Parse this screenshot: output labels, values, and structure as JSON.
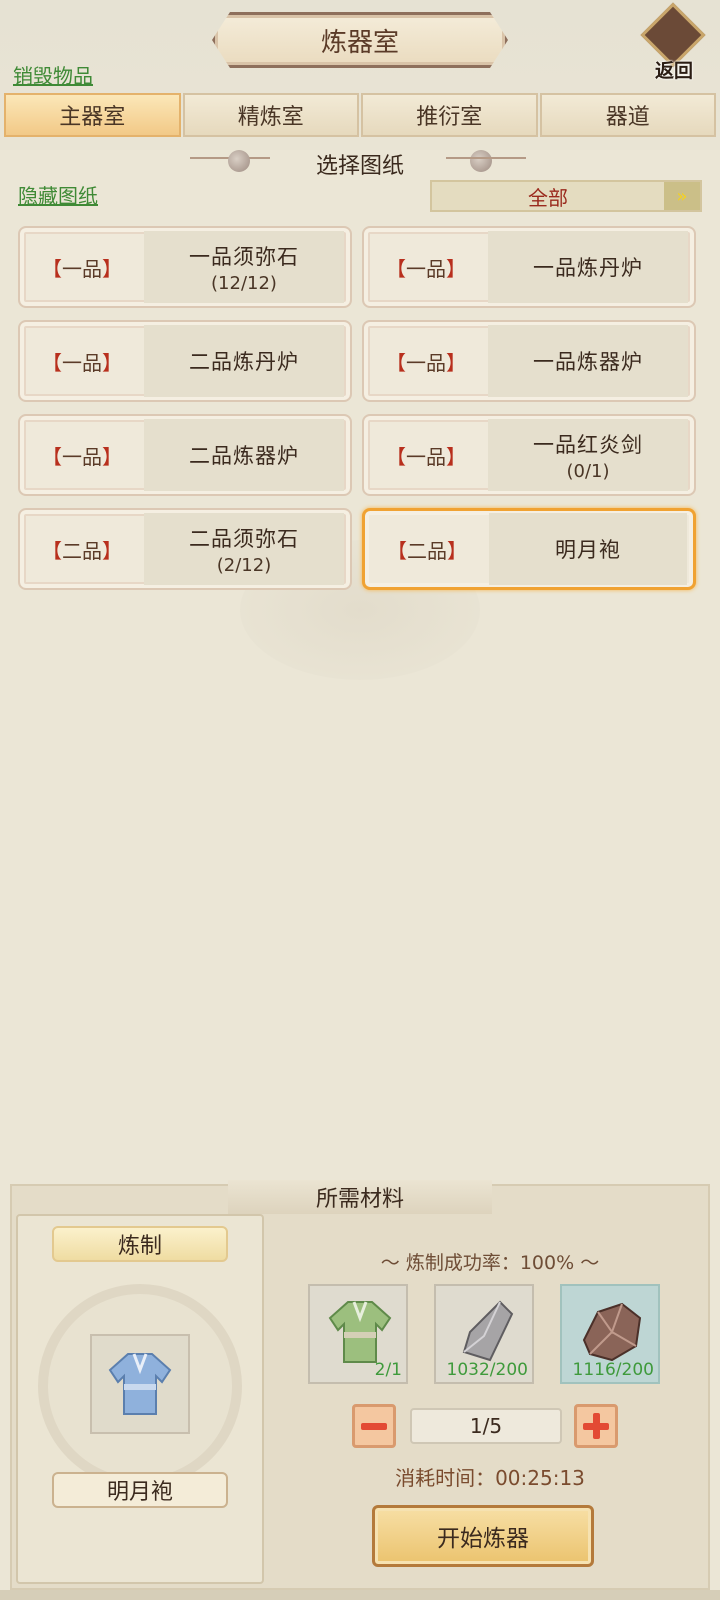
{
  "header": {
    "title": "炼器室",
    "back_label": "返回",
    "destroy_link": "销毁物品"
  },
  "tabs": [
    {
      "label": "主器室",
      "active": true
    },
    {
      "label": "精炼室",
      "active": false
    },
    {
      "label": "推衍室",
      "active": false
    },
    {
      "label": "器道",
      "active": false
    }
  ],
  "blueprints": {
    "section_title": "选择图纸",
    "hide_link": "隐藏图纸",
    "filter_value": "全部",
    "items": [
      {
        "grade": "一品",
        "name": "一品须弥石",
        "count": "(12/12)",
        "selected": false
      },
      {
        "grade": "一品",
        "name": "一品炼丹炉",
        "count": "",
        "selected": false
      },
      {
        "grade": "一品",
        "name": "二品炼丹炉",
        "count": "",
        "selected": false
      },
      {
        "grade": "一品",
        "name": "一品炼器炉",
        "count": "",
        "selected": false
      },
      {
        "grade": "一品",
        "name": "二品炼器炉",
        "count": "",
        "selected": false
      },
      {
        "grade": "一品",
        "name": "一品红炎剑",
        "count": "(0/1)",
        "selected": false
      },
      {
        "grade": "二品",
        "name": "二品须弥石",
        "count": "(2/12)",
        "selected": false
      },
      {
        "grade": "二品",
        "name": "明月袍",
        "count": "",
        "selected": true
      }
    ]
  },
  "materials": {
    "title": "所需材料",
    "craft_label": "炼制",
    "target_item": "明月袍",
    "success_rate_label": "炼制成功率：",
    "success_rate_value": "100%",
    "items": [
      {
        "icon": "green-robe-icon",
        "count": "2/1"
      },
      {
        "icon": "grey-stone-icon",
        "count": "1032/200"
      },
      {
        "icon": "brown-ore-icon",
        "count": "1116/200"
      }
    ],
    "quantity": "1/5",
    "time_label": "消耗时间：",
    "time_value": "00:25:13",
    "start_button": "开始炼器"
  },
  "colors": {
    "link_green": "#3f8a36",
    "grade_bracket_red": "#b82f1d",
    "selected_border": "#f0a232",
    "count_green": "#3f9a3c",
    "filter_text_red": "#9a2a1d"
  }
}
